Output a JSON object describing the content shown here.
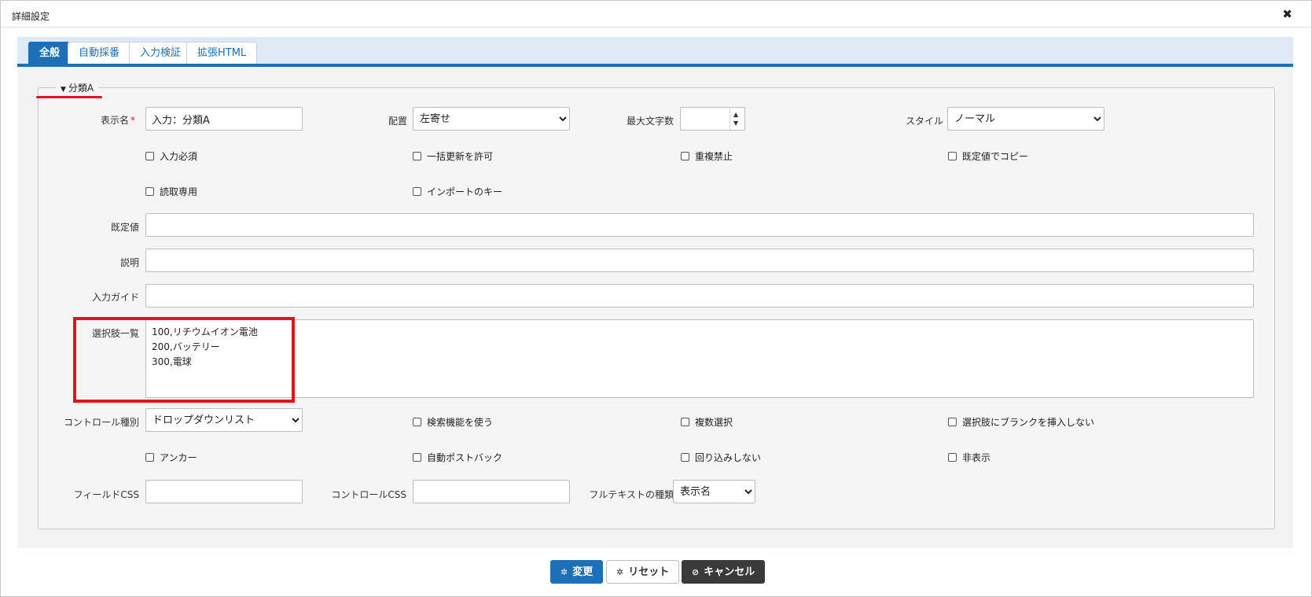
{
  "dialog": {
    "title": "詳細設定",
    "close_icon": "✖"
  },
  "tabs": [
    {
      "label": "全般",
      "active": true
    },
    {
      "label": "自動採番",
      "active": false
    },
    {
      "label": "入力検証",
      "active": false
    },
    {
      "label": "拡張HTML",
      "active": false
    }
  ],
  "section": {
    "legend": "分類A",
    "toggle_icon": "▼"
  },
  "form": {
    "display_name": {
      "label": "表示名",
      "required_mark": "*",
      "value": "入力：分類A"
    },
    "alignment": {
      "label": "配置",
      "value": "左寄せ"
    },
    "max_length": {
      "label": "最大文字数",
      "value": ""
    },
    "style": {
      "label": "スタイル",
      "value": "ノーマル"
    },
    "checkboxes_row1": [
      "入力必須",
      "一括更新を許可",
      "重複禁止",
      "既定値でコピー"
    ],
    "checkboxes_row2": [
      "読取専用",
      "インポートのキー"
    ],
    "default_value": {
      "label": "既定値",
      "value": ""
    },
    "description": {
      "label": "説明",
      "value": ""
    },
    "input_guide": {
      "label": "入力ガイド",
      "value": ""
    },
    "choices": {
      "label": "選択肢一覧",
      "value": "100,リチウムイオン電池\n200,バッテリー\n300,電球"
    },
    "control_type": {
      "label": "コントロール種別",
      "value": "ドロップダウンリスト"
    },
    "checkboxes_row3": [
      "検索機能を使う",
      "複数選択",
      "選択肢にブランクを挿入しない"
    ],
    "checkboxes_row4": [
      "アンカー",
      "自動ポストバック",
      "回り込みしない",
      "非表示"
    ],
    "field_css": {
      "label": "フィールドCSS",
      "value": ""
    },
    "control_css": {
      "label": "コントロールCSS",
      "value": ""
    },
    "fulltext_type": {
      "label": "フルテキストの種類",
      "value": "表示名"
    }
  },
  "buttons": {
    "update": {
      "label": "変更",
      "icon": "✲"
    },
    "reset": {
      "label": "リセット",
      "icon": "✲"
    },
    "cancel": {
      "label": "キャンセル",
      "icon": "⊘"
    }
  },
  "colors": {
    "accent": "#1d6fb8",
    "highlight": "#e0141e"
  }
}
